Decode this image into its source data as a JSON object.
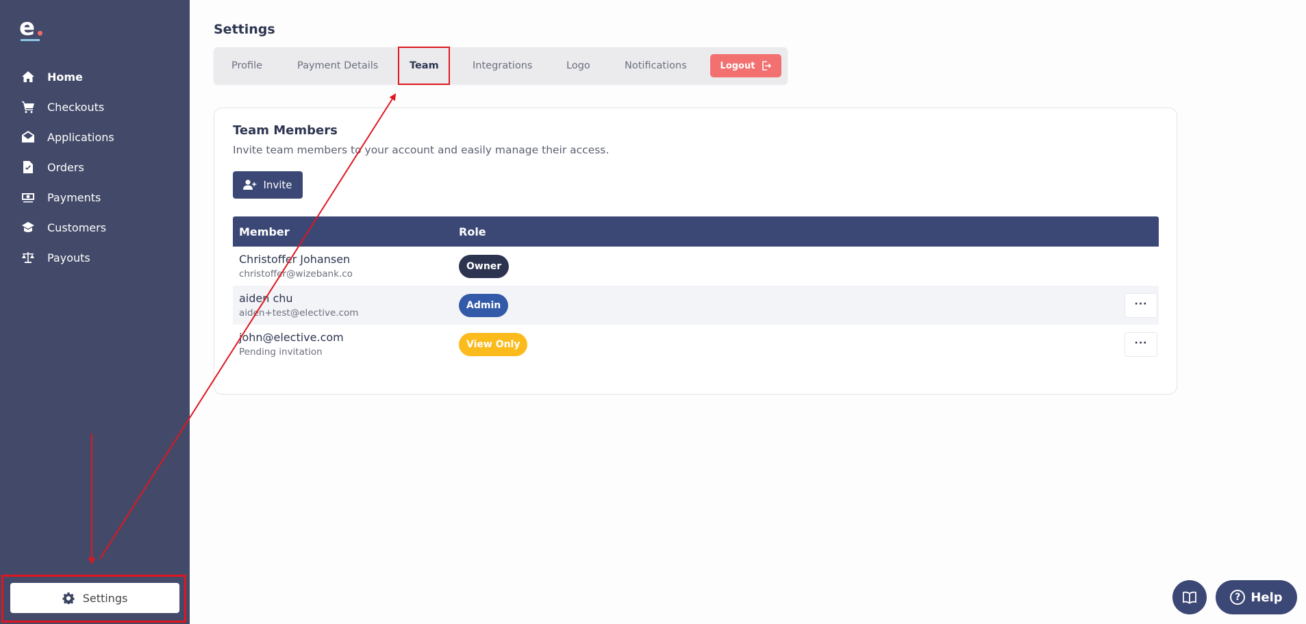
{
  "app": {
    "logo_letter": "e"
  },
  "sidebar": {
    "items": [
      {
        "label": "Home",
        "icon": "home-icon",
        "active": true
      },
      {
        "label": "Checkouts",
        "icon": "cart-icon"
      },
      {
        "label": "Applications",
        "icon": "envelope-icon"
      },
      {
        "label": "Orders",
        "icon": "file-check-icon"
      },
      {
        "label": "Payments",
        "icon": "money-icon"
      },
      {
        "label": "Customers",
        "icon": "graduation-cap-icon"
      },
      {
        "label": "Payouts",
        "icon": "scale-icon"
      }
    ],
    "settings_label": "Settings"
  },
  "page": {
    "title": "Settings"
  },
  "tabs": {
    "items": [
      "Profile",
      "Payment Details",
      "Team",
      "Integrations",
      "Logo",
      "Notifications"
    ],
    "active": "Team",
    "logout_label": "Logout"
  },
  "team": {
    "title": "Team Members",
    "subtitle": "Invite team members to your account and easily manage their access.",
    "invite_label": "Invite",
    "columns": [
      "Member",
      "Role"
    ],
    "rows": [
      {
        "name": "Christoffer Johansen",
        "sub": "christoffer@wizebank.co",
        "role": "Owner"
      },
      {
        "name": "aiden chu",
        "sub": "aiden+test@elective.com",
        "role": "Admin"
      },
      {
        "name": "john@elective.com",
        "sub": "Pending invitation",
        "role": "View Only"
      }
    ]
  },
  "help": {
    "label": "Help",
    "q_glyph": "?"
  },
  "colors": {
    "sidebar_bg": "#434a69",
    "primary": "#3b4775",
    "logout": "#f27070",
    "owner_badge": "#2c3450",
    "admin_badge": "#325aa8",
    "view_badge": "#fcbb1d",
    "annotation": "#e0161f"
  }
}
